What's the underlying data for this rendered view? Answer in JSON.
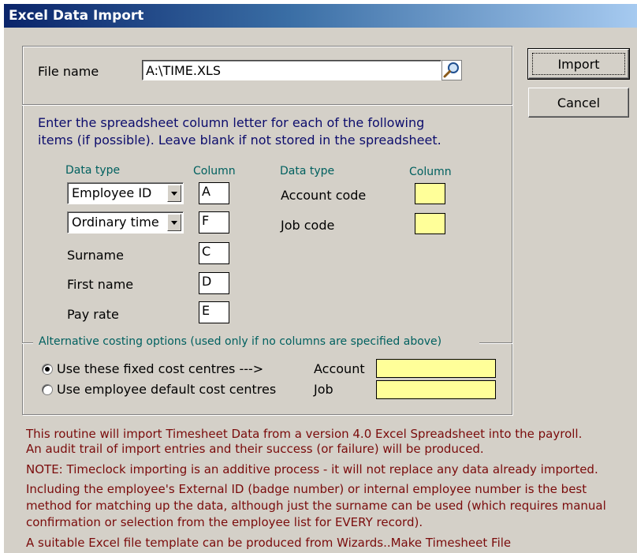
{
  "window": {
    "title": "Excel Data Import"
  },
  "file": {
    "label": "File name",
    "value": "A:\\TIME.XLS"
  },
  "buttons": {
    "import": "Import",
    "cancel": "Cancel"
  },
  "instructions": [
    "Enter the spreadsheet column letter for each of the following",
    "items (if possible). Leave blank if not stored in the spreadsheet."
  ],
  "headers": {
    "data_type_left": "Data type",
    "column_left": "Column",
    "data_type_right": "Data type",
    "column_right": "Column"
  },
  "left_rows": [
    {
      "kind": "select",
      "label": "Employee ID",
      "column": "A"
    },
    {
      "kind": "select",
      "label": "Ordinary time",
      "column": "F"
    },
    {
      "kind": "text",
      "label": "Surname",
      "column": "C"
    },
    {
      "kind": "text",
      "label": "First name",
      "column": "D"
    },
    {
      "kind": "text",
      "label": "Pay rate",
      "column": "E"
    }
  ],
  "right_rows": [
    {
      "label": "Account code",
      "column": ""
    },
    {
      "label": "Job code",
      "column": ""
    }
  ],
  "alt_costing": {
    "legend": "Alternative costing options (used only if no columns are specified above)",
    "option_fixed": "Use these fixed cost centres --->",
    "option_default": "Use employee default cost centres",
    "selected": "fixed",
    "account_label": "Account",
    "account_value": "",
    "job_label": "Job",
    "job_value": ""
  },
  "notes": [
    "This routine will import Timesheet Data from a version 4.0 Excel Spreadsheet into the payroll.",
    "An audit trail of import entries and their success (or failure) will be produced.",
    "NOTE: Timeclock importing is an additive process - it will not replace any data already imported.",
    "Including the employee's External ID (badge number) or internal employee number is the best",
    "method for matching up the data, although just the surname can be used (which requires manual",
    "confirmation or selection from the employee list for EVERY record).",
    "A suitable Excel file template can be produced from Wizards..Make Timesheet File"
  ],
  "colors": {
    "title_start": "#0a246a",
    "title_end": "#a6caf0",
    "highlight": "#ffff99",
    "note_text": "#7a0b0b",
    "header_text": "#00605f",
    "instruction_text": "#0c0c6c"
  }
}
